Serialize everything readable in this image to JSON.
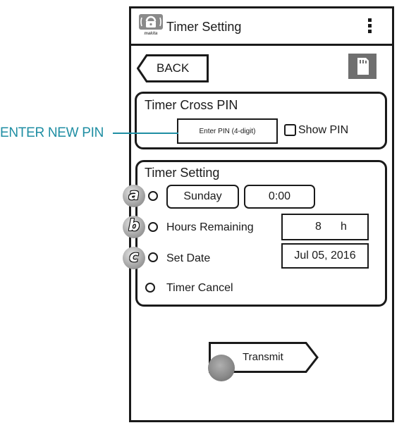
{
  "header": {
    "title": "Timer Setting",
    "logo_icon": "makita-lock-icon",
    "menu_icon": "kebab-menu-icon"
  },
  "toolbar": {
    "back_label": "BACK",
    "device_icon": "sd-card-icon"
  },
  "pin_panel": {
    "title": "Timer Cross PIN",
    "input_placeholder": "Enter PIN (4-digit)",
    "show_pin_label": "Show PIN",
    "show_pin_checked": false
  },
  "annotation": {
    "enter_new_pin": "ENTER NEW PIN",
    "color": "#1f8ea3"
  },
  "timer_panel": {
    "title": "Timer Setting",
    "options": {
      "day_time": {
        "badge": "a",
        "day": "Sunday",
        "time": "0:00",
        "selected": false
      },
      "hours": {
        "badge": "b",
        "label": "Hours Remaining",
        "value": "8",
        "unit": "h",
        "selected": false
      },
      "date": {
        "badge": "c",
        "label": "Set Date",
        "value": "Jul 05, 2016",
        "selected": false
      },
      "cancel": {
        "label": "Timer Cancel",
        "selected": false
      }
    }
  },
  "transmit": {
    "label": "Transmit"
  }
}
